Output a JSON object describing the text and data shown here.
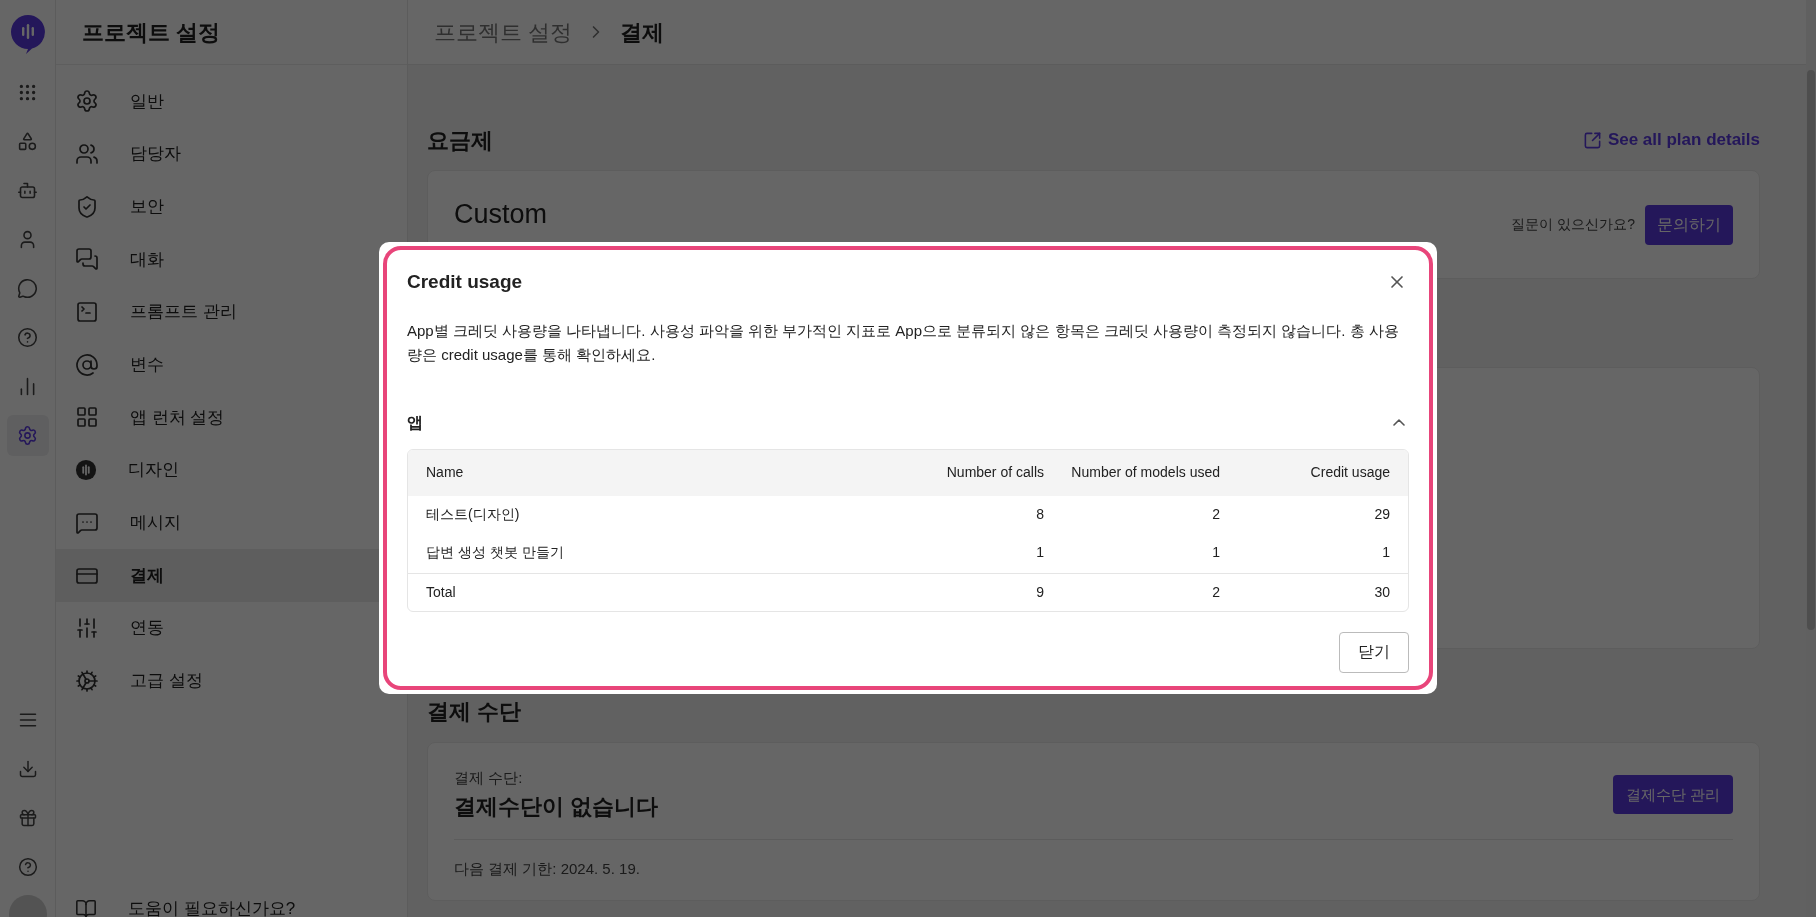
{
  "rail": {
    "items": [
      {
        "selected": false
      },
      {
        "selected": false
      },
      {
        "selected": false
      },
      {
        "selected": false
      },
      {
        "selected": false
      },
      {
        "selected": false
      },
      {
        "selected": false
      },
      {
        "selected": true
      }
    ]
  },
  "sidebar": {
    "title": "프로젝트 설정",
    "items": [
      {
        "label": "일반",
        "selected": false
      },
      {
        "label": "담당자",
        "selected": false
      },
      {
        "label": "보안",
        "selected": false
      },
      {
        "label": "대화",
        "selected": false
      },
      {
        "label": "프롬프트 관리",
        "selected": false
      },
      {
        "label": "변수",
        "selected": false
      },
      {
        "label": "앱 런처 설정",
        "selected": false
      },
      {
        "label": "디자인",
        "selected": false
      },
      {
        "label": "메시지",
        "selected": false
      },
      {
        "label": "결제",
        "selected": true
      },
      {
        "label": "연동",
        "selected": false
      },
      {
        "label": "고급 설정",
        "selected": false
      }
    ],
    "help": "도움이 필요하신가요?"
  },
  "breadcrumb": [
    "프로젝트 설정",
    "결제"
  ],
  "plan": {
    "heading": "요금제",
    "link": "See all plan details",
    "name": "Custom",
    "question": "질문이 있으신가요?",
    "button": "문의하기"
  },
  "payment": {
    "heading": "결제 수단",
    "label": "결제 수단:",
    "value": "결제수단이 없습니다",
    "button": "결제수단 관리",
    "next": "다음 결제 기한: 2024. 5. 19."
  },
  "dialog": {
    "title": "Credit usage",
    "description": "App별 크레딧 사용량을 나타냅니다. 사용성 파악을 위한 부가적인 지표로 App으로 분류되지 않은 항목은 크레딧 사용량이 측정되지 않습니다. 총 사용량은 credit usage를 통해 확인하세요.",
    "section": {
      "title": "앱",
      "expanded": true
    },
    "table": {
      "columns": [
        "Name",
        "Number of calls",
        "Number of models used",
        "Credit usage"
      ],
      "rows": [
        [
          "테스트(디자인)",
          "8",
          "2",
          "29"
        ],
        [
          "답변 생성 챗봇 만들기",
          "1",
          "1",
          "1"
        ]
      ],
      "total": [
        "Total",
        "9",
        "2",
        "30"
      ]
    },
    "close_button": "닫기"
  }
}
